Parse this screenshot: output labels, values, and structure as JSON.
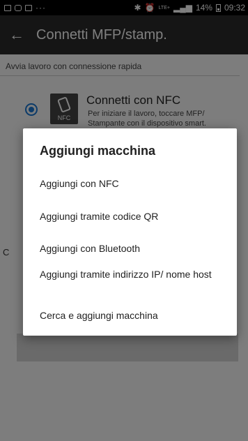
{
  "status_bar": {
    "left_icons": [
      "gallery-icon",
      "instagram-icon",
      "image-icon"
    ],
    "dots": "···",
    "network": "LTE+",
    "battery_percent": "14%",
    "time": "09:32"
  },
  "app_bar": {
    "title": "Connetti MFP/stamp."
  },
  "content": {
    "section_label": "Avvia lavoro con connessione rapida",
    "option": {
      "icon_label": "NFC",
      "title": "Connetti con NFC",
      "description": "Per iniziare il lavoro, toccare MFP/ Stampante con il dispositivo smart."
    },
    "partial_letter": "C"
  },
  "dialog": {
    "title": "Aggiungi macchina",
    "items": [
      {
        "label": "Aggiungi con NFC"
      },
      {
        "label": "Aggiungi tramite codice QR"
      },
      {
        "label": "Aggiungi con Bluetooth"
      },
      {
        "label": "Aggiungi tramite indirizzo IP/ nome host"
      },
      {
        "label": "Cerca e aggiungi macchina"
      }
    ]
  }
}
